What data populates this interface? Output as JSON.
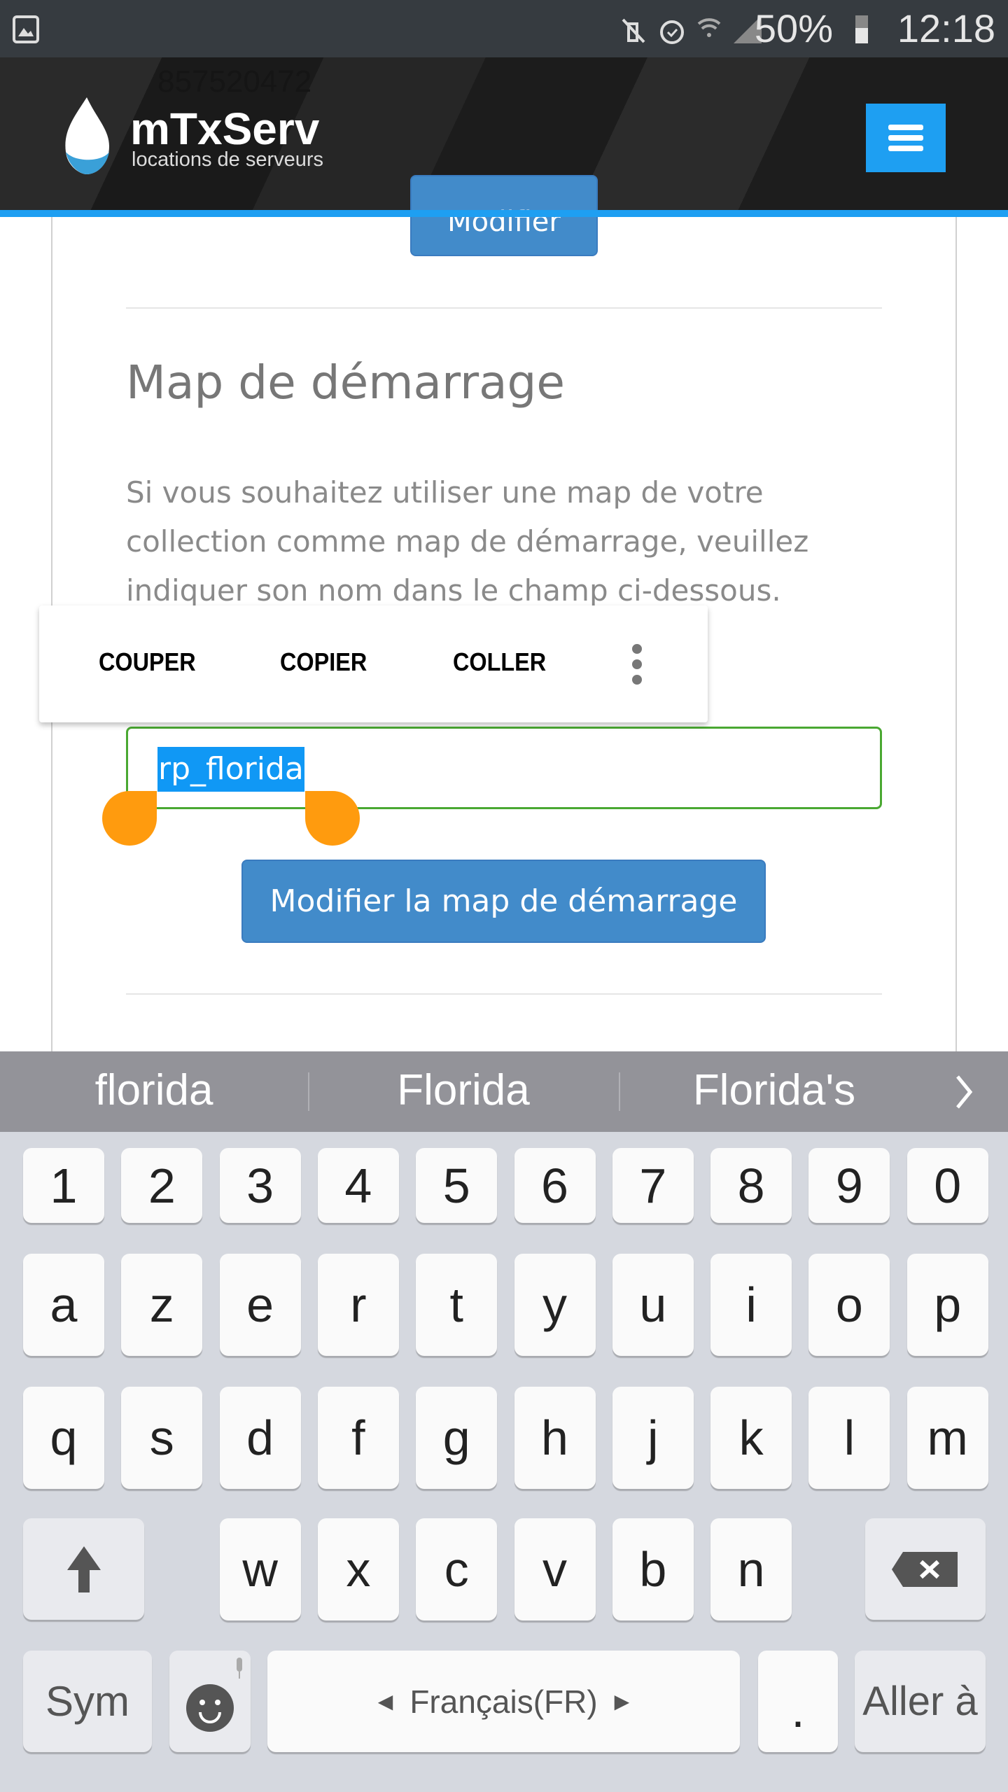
{
  "status_bar": {
    "battery": "50%",
    "time": "12:18",
    "icons": [
      "gallery-icon",
      "vibrate-mute-icon",
      "alarm-icon",
      "wifi-icon",
      "signal-icon",
      "battery-icon"
    ]
  },
  "header": {
    "logo_title": "mTxServ",
    "logo_subtitle": "locations de serveurs",
    "behind_text": "857520472",
    "menu_color": "#1e9ff2"
  },
  "page": {
    "prev_button": "Modifier",
    "heading": "Map de démarrage",
    "paragraph": "Si vous souhaitez utiliser une map de votre collection comme map de démarrage, veuillez indiquer son nom dans le champ ci-dessous.",
    "input_value": "rp_florida",
    "submit_button": "Modifier la map de démarrage"
  },
  "context_menu": {
    "items": [
      "COUPER",
      "COPIER",
      "COLLER"
    ],
    "more": "more-vert-icon"
  },
  "keyboard": {
    "suggestions": [
      "florida",
      "Florida",
      "Florida's"
    ],
    "numbers": [
      "1",
      "2",
      "3",
      "4",
      "5",
      "6",
      "7",
      "8",
      "9",
      "0"
    ],
    "row1": [
      "a",
      "z",
      "e",
      "r",
      "t",
      "y",
      "u",
      "i",
      "o",
      "p"
    ],
    "row2": [
      "q",
      "s",
      "d",
      "f",
      "g",
      "h",
      "j",
      "k",
      "l",
      "m"
    ],
    "row3": [
      "w",
      "x",
      "c",
      "v",
      "b",
      "n"
    ],
    "sym": "Sym",
    "space": "Français(FR)",
    "period": ".",
    "go": "Aller à"
  }
}
